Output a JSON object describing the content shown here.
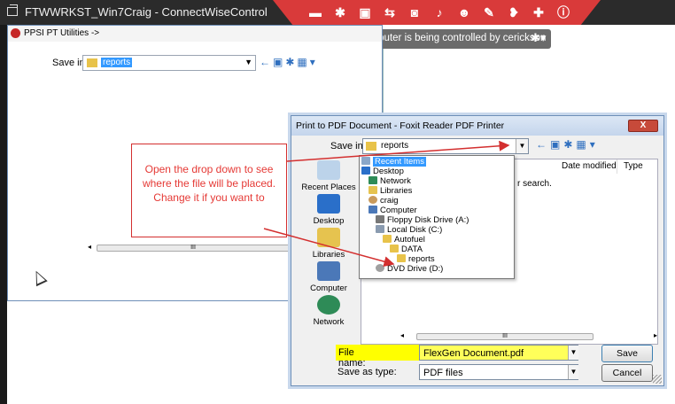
{
  "connectwise": {
    "window_title": "FTWWRKST_Win7Craig - ConnectWiseControl",
    "banner_text": "Your computer is being controlled by cerickson",
    "toolbar_icons": [
      "monitor-icon",
      "gear-icon",
      "toolbox-icon",
      "transfer-icon",
      "image-icon",
      "microphone-icon",
      "users-icon",
      "pen-icon",
      "chat-icon",
      "plus-icon",
      "info-icon"
    ],
    "accent_color": "#d93a3a"
  },
  "background_dialog": {
    "app_title": "PPSI PT Utilities ->",
    "save_in_label": "Save in:",
    "save_in_value": "reports",
    "scroll_thumb": "III"
  },
  "foxit_dialog": {
    "title": "Print to PDF Document - Foxit Reader PDF Printer",
    "close_label": "X",
    "save_in_label": "Save in:",
    "save_in_value": "reports",
    "places": [
      "Recent Places",
      "Desktop",
      "Libraries",
      "Computer",
      "Network"
    ],
    "columns": [
      "Date modified",
      "Type"
    ],
    "empty_text": "r search.",
    "scroll_thumb": "III",
    "dropdown_items": [
      {
        "label": "Recent Items",
        "icon": "recent-items-icon",
        "selected": true
      },
      {
        "label": "Desktop",
        "icon": "desktop-icon",
        "selected": false
      },
      {
        "label": "Network",
        "icon": "network-icon",
        "selected": false
      },
      {
        "label": "Libraries",
        "icon": "libraries-icon",
        "selected": false
      },
      {
        "label": "craig",
        "icon": "user-icon",
        "selected": false
      },
      {
        "label": "Computer",
        "icon": "computer-icon",
        "selected": false
      },
      {
        "label": "Floppy Disk Drive (A:)",
        "icon": "floppy-icon",
        "selected": false
      },
      {
        "label": "Local Disk (C:)",
        "icon": "disk-icon",
        "selected": false
      },
      {
        "label": "Autofuel",
        "icon": "folder-icon",
        "selected": false
      },
      {
        "label": "DATA",
        "icon": "folder-icon",
        "selected": false
      },
      {
        "label": "reports",
        "icon": "folder-icon",
        "selected": false
      },
      {
        "label": "DVD Drive (D:)",
        "icon": "dvd-icon",
        "selected": false
      }
    ],
    "file_name_label": "File name:",
    "file_name_value": "FlexGen Document.pdf",
    "save_as_type_label": "Save as type:",
    "save_as_type_value": "PDF files",
    "save_button": "Save",
    "cancel_button": "Cancel"
  },
  "callout": {
    "text": "Open the drop down to see where the file will be placed. Change it if you want to",
    "color": "#e53935"
  }
}
